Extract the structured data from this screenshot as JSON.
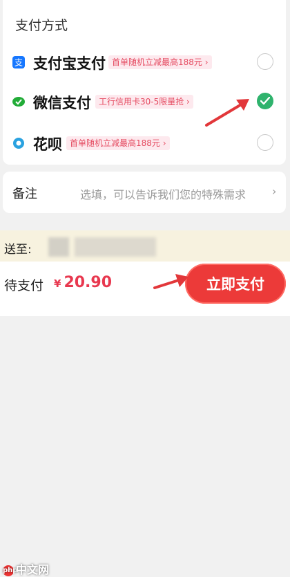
{
  "payment_section": {
    "title": "支付方式",
    "methods": [
      {
        "name": "支付宝支付",
        "promo": "首单随机立减最高188元 ›",
        "icon": "alipay-icon",
        "selected": false
      },
      {
        "name": "微信支付",
        "promo": "工行信用卡30-5限量抢 ›",
        "icon": "wechat-pay-icon",
        "selected": true
      },
      {
        "name": "花呗",
        "promo": "首单随机立减最高188元 ›",
        "icon": "huabei-icon",
        "selected": false
      }
    ]
  },
  "remark": {
    "label": "备注",
    "placeholder": "选填，可以告诉我们您的特殊需求",
    "chevron": "›"
  },
  "shipping": {
    "label": "送至:"
  },
  "footer": {
    "due_label": "待支付",
    "currency": "¥",
    "amount": "20.90",
    "pay_button": "立即支付"
  },
  "watermark": {
    "text": "中文网",
    "logo": "php"
  },
  "colors": {
    "accent_red": "#ec3a39",
    "check_green": "#2fb36d",
    "promo_text": "#e54b61",
    "annotation_arrow": "#e2373a"
  }
}
